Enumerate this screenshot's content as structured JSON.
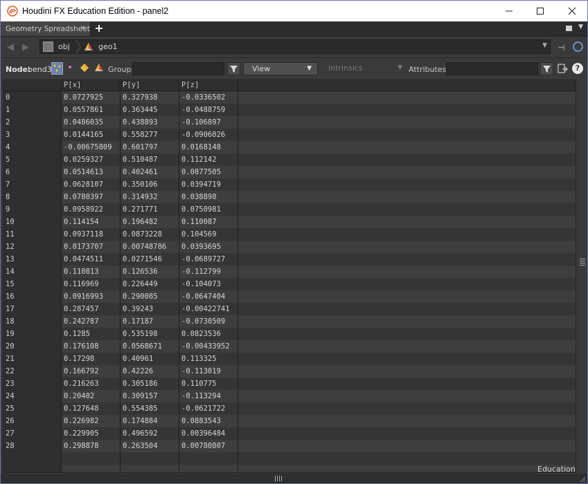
{
  "window": {
    "title": "Houdini FX Education Edition - panel2",
    "minimize_icon": "minimize-icon",
    "maximize_icon": "maximize-icon",
    "close_icon": "close-icon"
  },
  "tabs": [
    {
      "label": "Geometry Spreadsheet",
      "close": "×",
      "active": true
    }
  ],
  "path": {
    "root": "obj",
    "node": "geo1"
  },
  "toolbar": {
    "node_label": "Node:",
    "node_value": "bend3",
    "group_label": "Group:",
    "group_value": "",
    "view_label": "View",
    "intrinsics_label": "Intrinsics",
    "attributes_label": "Attributes:",
    "attributes_value": "",
    "help": "?"
  },
  "table": {
    "columns": [
      "",
      "P[x]",
      "P[y]",
      "P[z]"
    ],
    "rows": [
      [
        "0",
        "0.0727925",
        "0.327938",
        "-0.0336502"
      ],
      [
        "1",
        "0.0557861",
        "0.363445",
        "-0.0488759"
      ],
      [
        "2",
        "0.0486035",
        "0.438893",
        "-0.106897"
      ],
      [
        "3",
        "0.0144165",
        "0.558277",
        "-0.0906026"
      ],
      [
        "4",
        "-0.00675809",
        "0.601797",
        "0.0168148"
      ],
      [
        "5",
        "0.0259327",
        "0.510487",
        "0.112142"
      ],
      [
        "6",
        "0.0514613",
        "0.402461",
        "0.0877505"
      ],
      [
        "7",
        "0.0628107",
        "0.350106",
        "0.0394719"
      ],
      [
        "8",
        "0.0780397",
        "0.314932",
        "0.038898"
      ],
      [
        "9",
        "0.0958922",
        "0.271771",
        "0.0750981"
      ],
      [
        "10",
        "0.114154",
        "0.196482",
        "0.110087"
      ],
      [
        "11",
        "0.0937118",
        "0.0873228",
        "0.104569"
      ],
      [
        "12",
        "0.0173707",
        "0.00748786",
        "0.0393695"
      ],
      [
        "13",
        "0.0474511",
        "0.0271546",
        "-0.0689727"
      ],
      [
        "14",
        "0.110813",
        "0.126536",
        "-0.112799"
      ],
      [
        "15",
        "0.116969",
        "0.226449",
        "-0.104073"
      ],
      [
        "16",
        "0.0916993",
        "0.290085",
        "-0.0647404"
      ],
      [
        "17",
        "0.287457",
        "0.39243",
        "-0.00422741"
      ],
      [
        "18",
        "0.242787",
        "0.17187",
        "-0.0730509"
      ],
      [
        "19",
        "0.1285",
        "0.535198",
        "0.0823536"
      ],
      [
        "20",
        "0.176108",
        "0.0568671",
        "-0.00433952"
      ],
      [
        "21",
        "0.17298",
        "0.40961",
        "0.113325"
      ],
      [
        "22",
        "0.166792",
        "0.42226",
        "-0.113019"
      ],
      [
        "23",
        "0.216263",
        "0.305186",
        "0.110775"
      ],
      [
        "24",
        "0.20402",
        "0.309157",
        "-0.113294"
      ],
      [
        "25",
        "0.127648",
        "0.554385",
        "-0.0621722"
      ],
      [
        "26",
        "0.226982",
        "0.174884",
        "0.0883543"
      ],
      [
        "27",
        "0.229905",
        "0.496592",
        "0.00396484"
      ],
      [
        "28",
        "0.298878",
        "0.263504",
        "0.00780807"
      ]
    ]
  },
  "status": {
    "edition": "Education"
  },
  "colors": {
    "accent_border": "#6b73b8",
    "link_icon": "#6e8fd0",
    "logo": "#e25b2e"
  }
}
